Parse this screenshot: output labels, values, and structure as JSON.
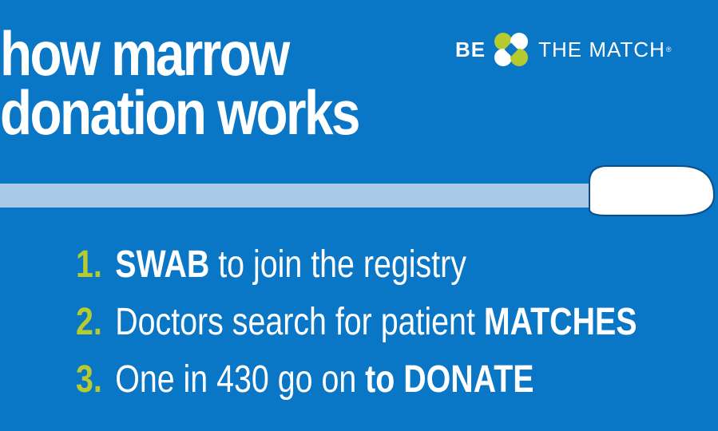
{
  "headline": {
    "line1": "how marrow",
    "line2": "donation works"
  },
  "logo": {
    "left_text": "BE",
    "right_text": "THE MATCH",
    "registered": "®",
    "mark_icon": "four-petal-match-logo-icon"
  },
  "illustration": {
    "icon": "cotton-swab-icon"
  },
  "colors": {
    "background": "#0a76c6",
    "accent_green": "#b5cb2f",
    "swab_stick": "#a9c9e9",
    "white": "#ffffff"
  },
  "steps": [
    {
      "number": "1.",
      "pre": "",
      "bold": "SWAB",
      "post": " to join the registry"
    },
    {
      "number": "2.",
      "pre": "Doctors search for patient ",
      "bold": "MATCHES",
      "post": ""
    },
    {
      "number": "3.",
      "pre": "One in 430 go on ",
      "bold": "to DONATE",
      "post": ""
    }
  ]
}
